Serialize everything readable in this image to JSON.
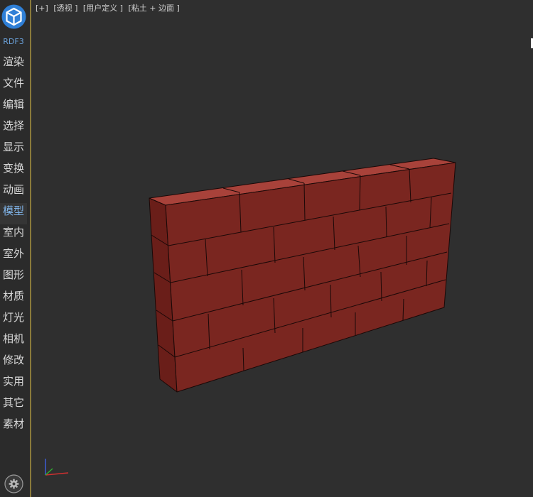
{
  "sidebar": {
    "logo_icon": "app-logo-cube-icon",
    "brand": "RDF3",
    "items": [
      {
        "label": "渲染",
        "active": false
      },
      {
        "label": "文件",
        "active": false
      },
      {
        "label": "编辑",
        "active": false
      },
      {
        "label": "选择",
        "active": false
      },
      {
        "label": "显示",
        "active": false
      },
      {
        "label": "变换",
        "active": false
      },
      {
        "label": "动画",
        "active": false
      },
      {
        "label": "模型",
        "active": true
      },
      {
        "label": "室内",
        "active": false
      },
      {
        "label": "室外",
        "active": false
      },
      {
        "label": "图形",
        "active": false
      },
      {
        "label": "材质",
        "active": false
      },
      {
        "label": "灯光",
        "active": false
      },
      {
        "label": "相机",
        "active": false
      },
      {
        "label": "修改",
        "active": false
      },
      {
        "label": "实用",
        "active": false
      },
      {
        "label": "其它",
        "active": false
      },
      {
        "label": "素材",
        "active": false
      }
    ],
    "settings_icon": "gear-icon"
  },
  "viewport": {
    "labels": {
      "plus": "[+]",
      "view": "[透视 ]",
      "camera": "[用户定义 ]",
      "shading": "[粘土 + 边面 ]"
    },
    "object_color": "#7a2620",
    "axis_colors": {
      "x": "#d03030",
      "y": "#30b030",
      "z": "#4060e0"
    }
  }
}
